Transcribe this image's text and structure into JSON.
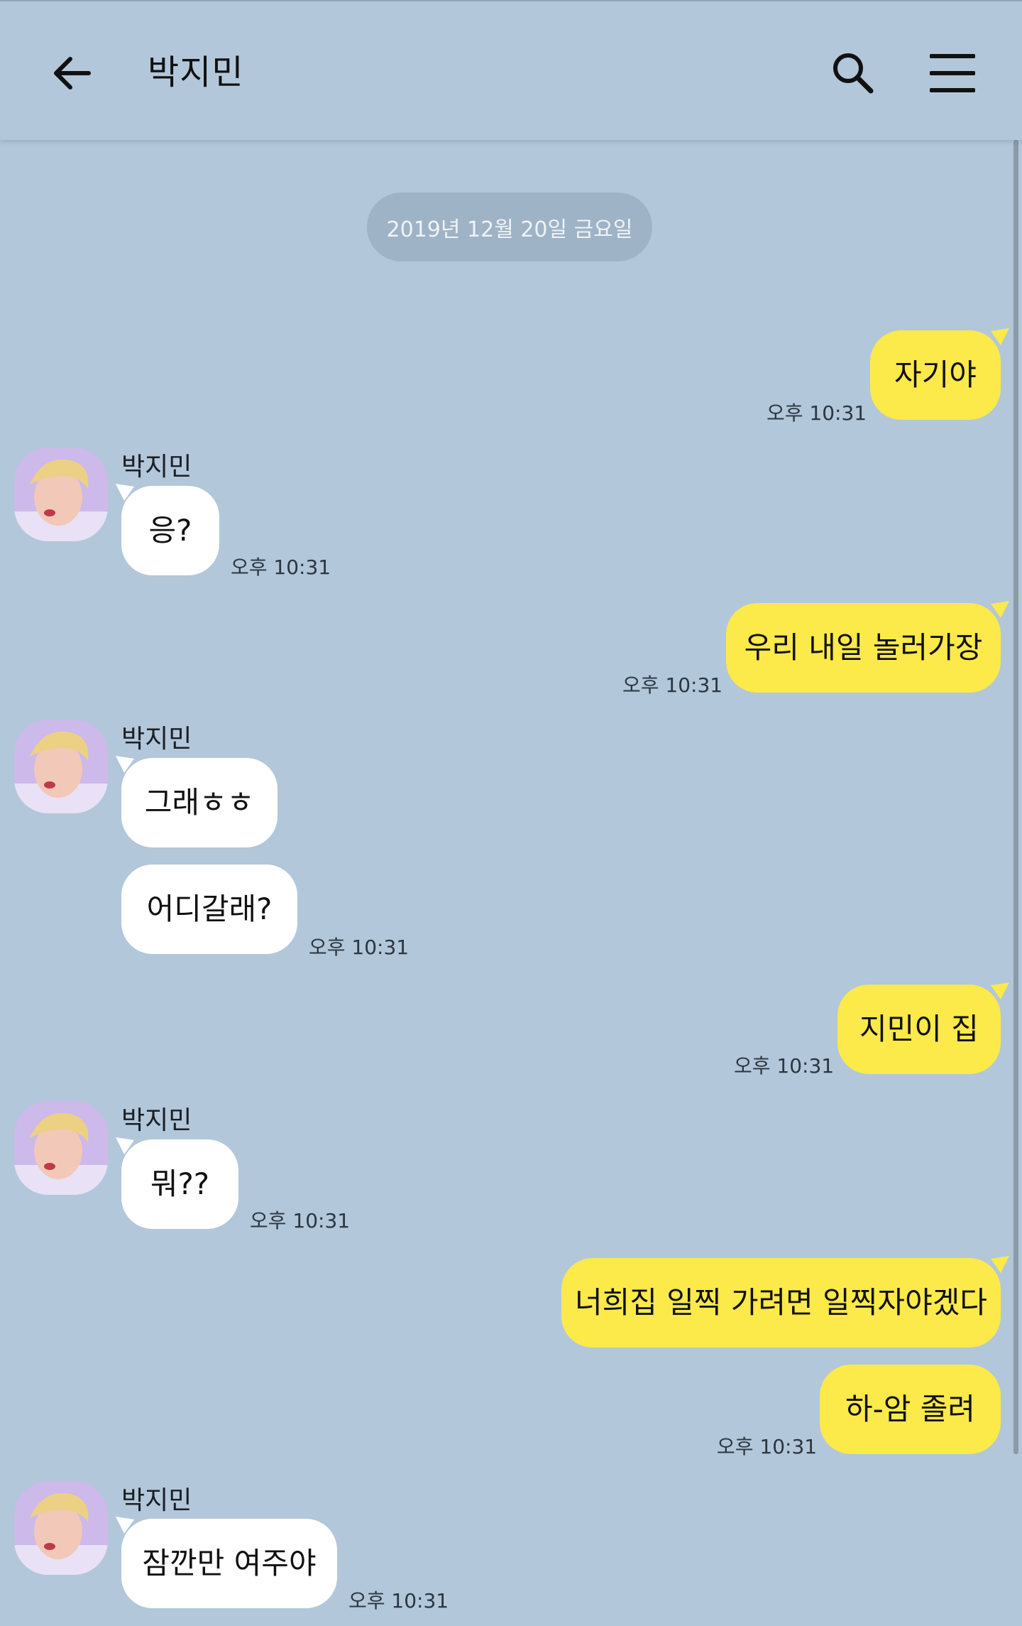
{
  "header": {
    "title": "박지민",
    "back_icon": "arrow-left-icon",
    "search_icon": "search-icon",
    "menu_icon": "hamburger-menu-icon"
  },
  "date_divider": "2019년 12월 20일 금요일",
  "colors": {
    "background": "#b2c7da",
    "my_bubble": "#fce94a",
    "their_bubble": "#ffffff",
    "date_chip": "#9fb3c6"
  },
  "messages": [
    {
      "sender": "me",
      "text": "자기야",
      "time": "오후 10:31"
    },
    {
      "sender": "박지민",
      "text": "응?",
      "time": "오후 10:31"
    },
    {
      "sender": "me",
      "text": "우리 내일 놀러가장",
      "time": "오후 10:31"
    },
    {
      "sender": "박지민",
      "text": "그래ㅎㅎ",
      "time": ""
    },
    {
      "sender": "박지민",
      "text": "어디갈래?",
      "time": "오후 10:31"
    },
    {
      "sender": "me",
      "text": "지민이 집",
      "time": "오후 10:31"
    },
    {
      "sender": "박지민",
      "text": "뭐??",
      "time": "오후 10:31"
    },
    {
      "sender": "me",
      "text": "너희집 일찍 가려면 일찍자야겠다",
      "time": ""
    },
    {
      "sender": "me",
      "text": "하-암 졸려",
      "time": "오후 10:31"
    },
    {
      "sender": "박지민",
      "text": "잠깐만 여주야",
      "time": "오후 10:31"
    }
  ],
  "sender_labels": [
    "박지민",
    "박지민",
    "박지민",
    "박지민"
  ]
}
